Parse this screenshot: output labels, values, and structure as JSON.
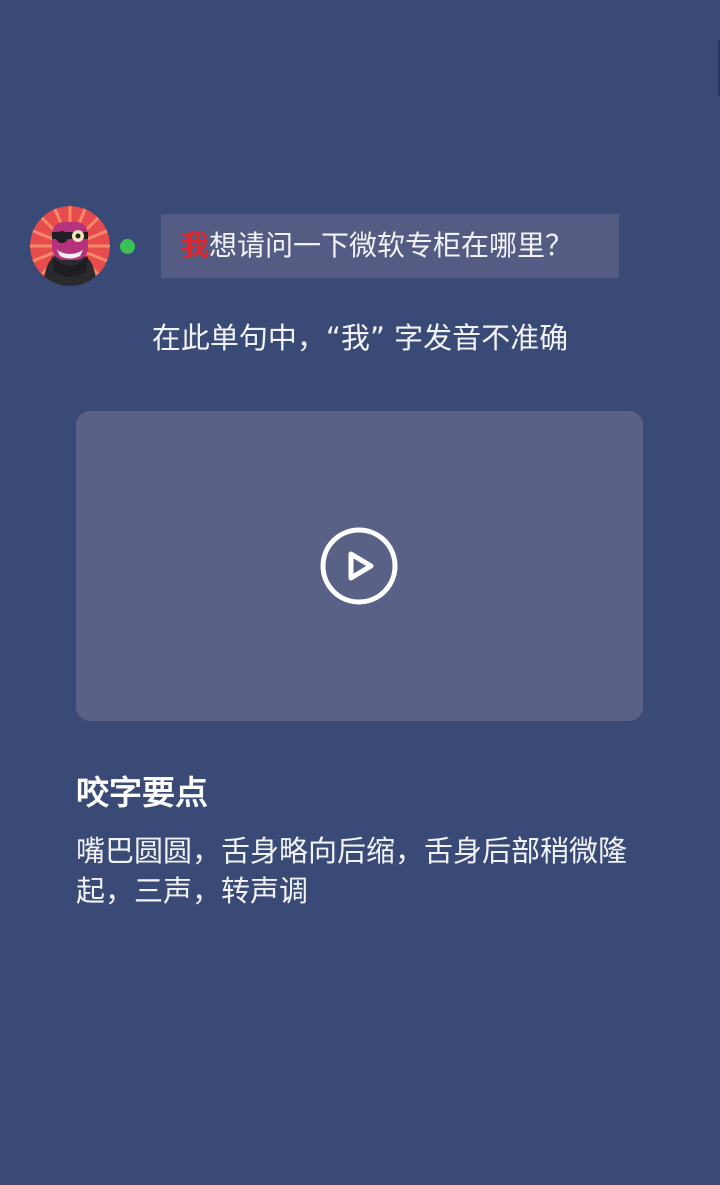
{
  "sentence": {
    "highlight": "我",
    "rest": "想请问一下微软专柜在哪里？"
  },
  "feedback": {
    "text": "在此单句中，“我” 字发音不准确"
  },
  "section": {
    "title": "咬字要点",
    "tips": "嘴巴圆圆，舌身略向后缩，舌身后部稍微隆起，三声，转声调"
  },
  "colors": {
    "background": "#3a4a76",
    "bubble": "#545c84",
    "highlight": "#e5252a",
    "online": "#3cbf54",
    "video_card": "#5a6186"
  },
  "icons": {
    "avatar": "pirate-avatar-icon",
    "play": "play-circle-icon"
  }
}
